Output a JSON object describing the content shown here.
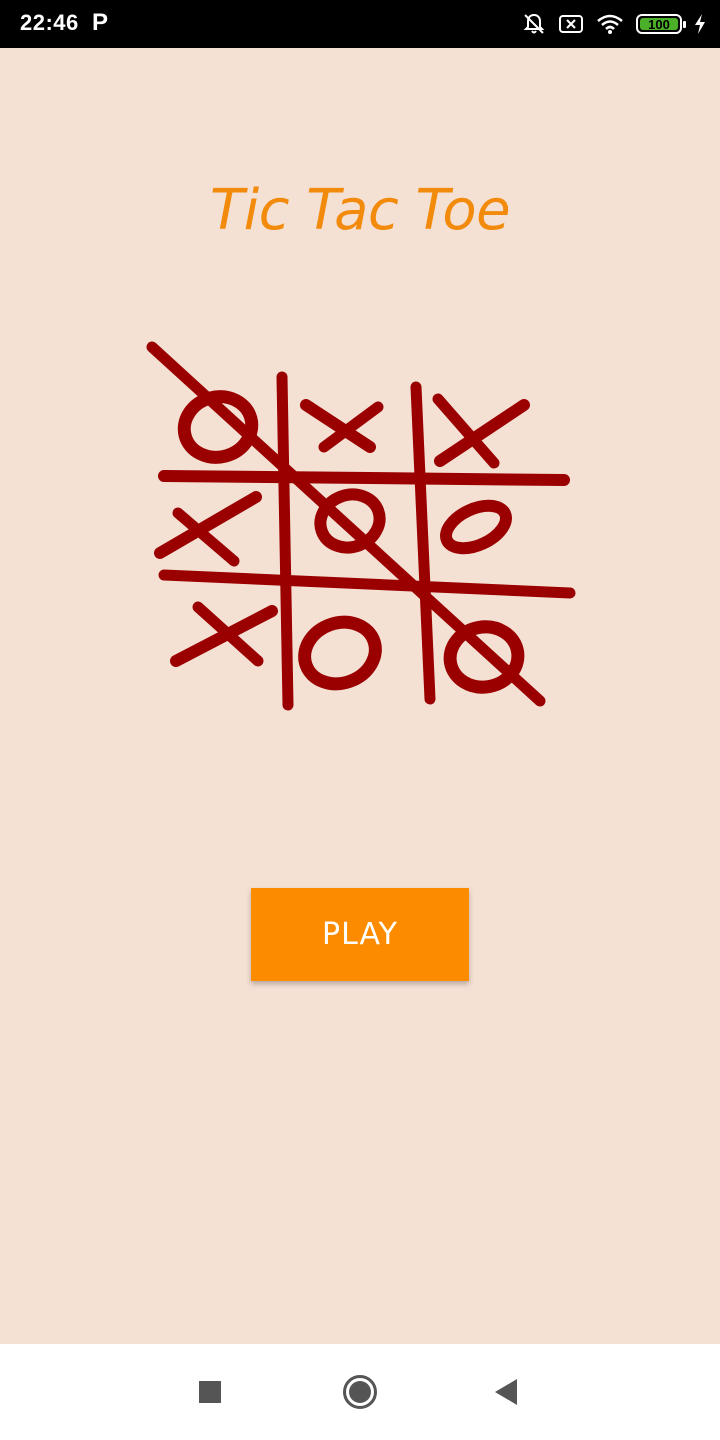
{
  "status_bar": {
    "time": "22:46",
    "notification_letter": "P",
    "battery_level": "100",
    "icons": [
      "mute-bell-icon",
      "sim-off-icon",
      "wifi-icon",
      "battery-icon",
      "charging-icon"
    ]
  },
  "app": {
    "title": "Tic Tac Toe",
    "play_label": "PLAY",
    "board_image": "tic-tac-toe-logo",
    "colors": {
      "background": "#f5e0d4",
      "title": "#f28a0c",
      "board_ink": "#9b0000",
      "button": "#fd8b00",
      "button_text": "#ffffff"
    }
  },
  "nav_bar": {
    "buttons": [
      "recent-apps-square-icon",
      "home-circle-icon",
      "back-triangle-icon"
    ]
  }
}
